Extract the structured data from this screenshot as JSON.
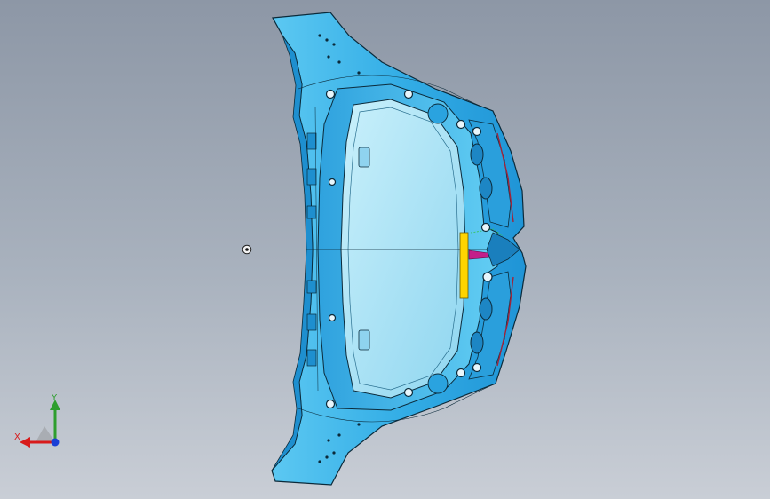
{
  "viewport": {
    "background_top": "#8d97a6",
    "background_bottom": "#c9ced6"
  },
  "model": {
    "part": "car-hood-inner-panel",
    "body_color": "#3cb6ea",
    "panel_color": "#aee3f5",
    "edge_color": "#0b2a3a",
    "highlight_color": "#ffd400",
    "accent_color": "#c21f8a"
  },
  "triad": {
    "x_label": "X",
    "y_label": "Y",
    "x_color": "#d81b1b",
    "y_color": "#2e9e2e",
    "z_color": "#1a3fd6"
  },
  "pivot_icon": "rotation-center-icon"
}
